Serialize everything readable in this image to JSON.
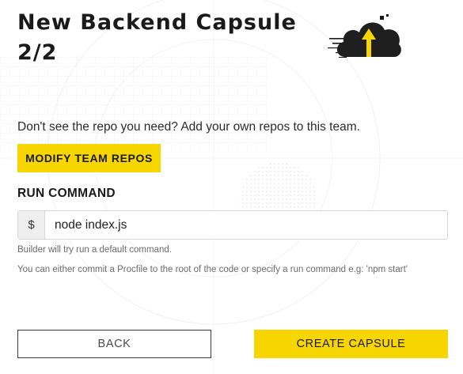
{
  "header": {
    "title_line1": "New Backend Capsule",
    "title_line2": "2/2",
    "logo_icon": "cloud-upload-icon"
  },
  "repos": {
    "info_text": "Don't see the repo you need? Add your own repos to this team.",
    "modify_label": "MODIFY TEAM REPOS"
  },
  "run_command": {
    "label": "RUN COMMAND",
    "prefix": "$",
    "value": "node index.js",
    "hint_default": "Builder will try run a default command.",
    "hint_procfile": "You can either commit a Procfile to the root of the code or specify a run command e.g: 'npm start'"
  },
  "actions": {
    "back_label": "BACK",
    "create_label": "CREATE CAPSULE"
  },
  "colors": {
    "accent": "#f7d600",
    "text_dark": "#1a1a1a",
    "hint": "#6b6b6b"
  }
}
